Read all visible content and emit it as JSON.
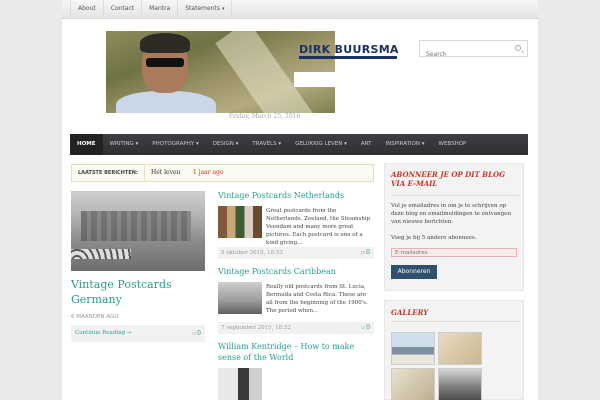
{
  "top_nav": {
    "items": [
      "About",
      "Contact",
      "Mantra",
      "Statements"
    ],
    "dropdown_indicator": "▾"
  },
  "header": {
    "brand": "DIRK BUURSMA",
    "date": "Friday, March 25, 2016"
  },
  "search": {
    "placeholder": "Search"
  },
  "main_nav": {
    "items": [
      {
        "label": "HOME",
        "active": true
      },
      {
        "label": "WRITING",
        "has_dropdown": true
      },
      {
        "label": "PHOTOGRAPHY",
        "has_dropdown": true
      },
      {
        "label": "DESIGN",
        "has_dropdown": true
      },
      {
        "label": "TRAVELS",
        "has_dropdown": true
      },
      {
        "label": "GELUKKIG LEVEN",
        "has_dropdown": true
      },
      {
        "label": "ART"
      },
      {
        "label": "INSPIRATION",
        "has_dropdown": true
      },
      {
        "label": "WEBSHOP"
      }
    ],
    "dropdown_indicator": "▾"
  },
  "ticker": {
    "label": "LAATSTE BERICHTEN:",
    "item": "Het leven",
    "when": "1 jaar ago"
  },
  "featured": {
    "title": "Vintage Postcards Germany",
    "age": "6 MAANDEN AGO",
    "more": "Continue Reading →",
    "comments": "0"
  },
  "posts": [
    {
      "title": "Vintage Postcards Netherlands",
      "excerpt": "Great postcards from the Netherlands. Zeeland, the Steamship Veendam and many more great pictures. Each postcard is one of a kind giving…",
      "date": "5 oktober 2015, 18:53",
      "comments": "0"
    },
    {
      "title": "Vintage Postcards Caribbean",
      "excerpt": "Really old postcards from St. Lucia, Bermuda and Costa Rica. These are all from the beginning of the 1900's. The period when…",
      "date": "7 september 2015, 18:52",
      "comments": "0"
    },
    {
      "title": "William Kentridge – How to make sense of the World"
    }
  ],
  "subscribe": {
    "title": "ABONNEER JE OP DIT BLOG VIA E-MAIL",
    "text": "Vul je emailadres in om je te schrijven op deze blog en emailmeldingen te ontvangen van nieuwe berichten.",
    "subscribers": "Voeg je bij 5 andere abonnees.",
    "email_placeholder": "E-mailadres",
    "button": "Abonneren"
  },
  "gallery": {
    "title": "GALLERY"
  },
  "comment_icon": "comment-icon",
  "colors": {
    "accent": "#2a9d8f",
    "sidebar_title": "#c0392b",
    "nav_bg": "#2d2f31",
    "brand": "#1a2f66",
    "button": "#2f4f6f"
  }
}
